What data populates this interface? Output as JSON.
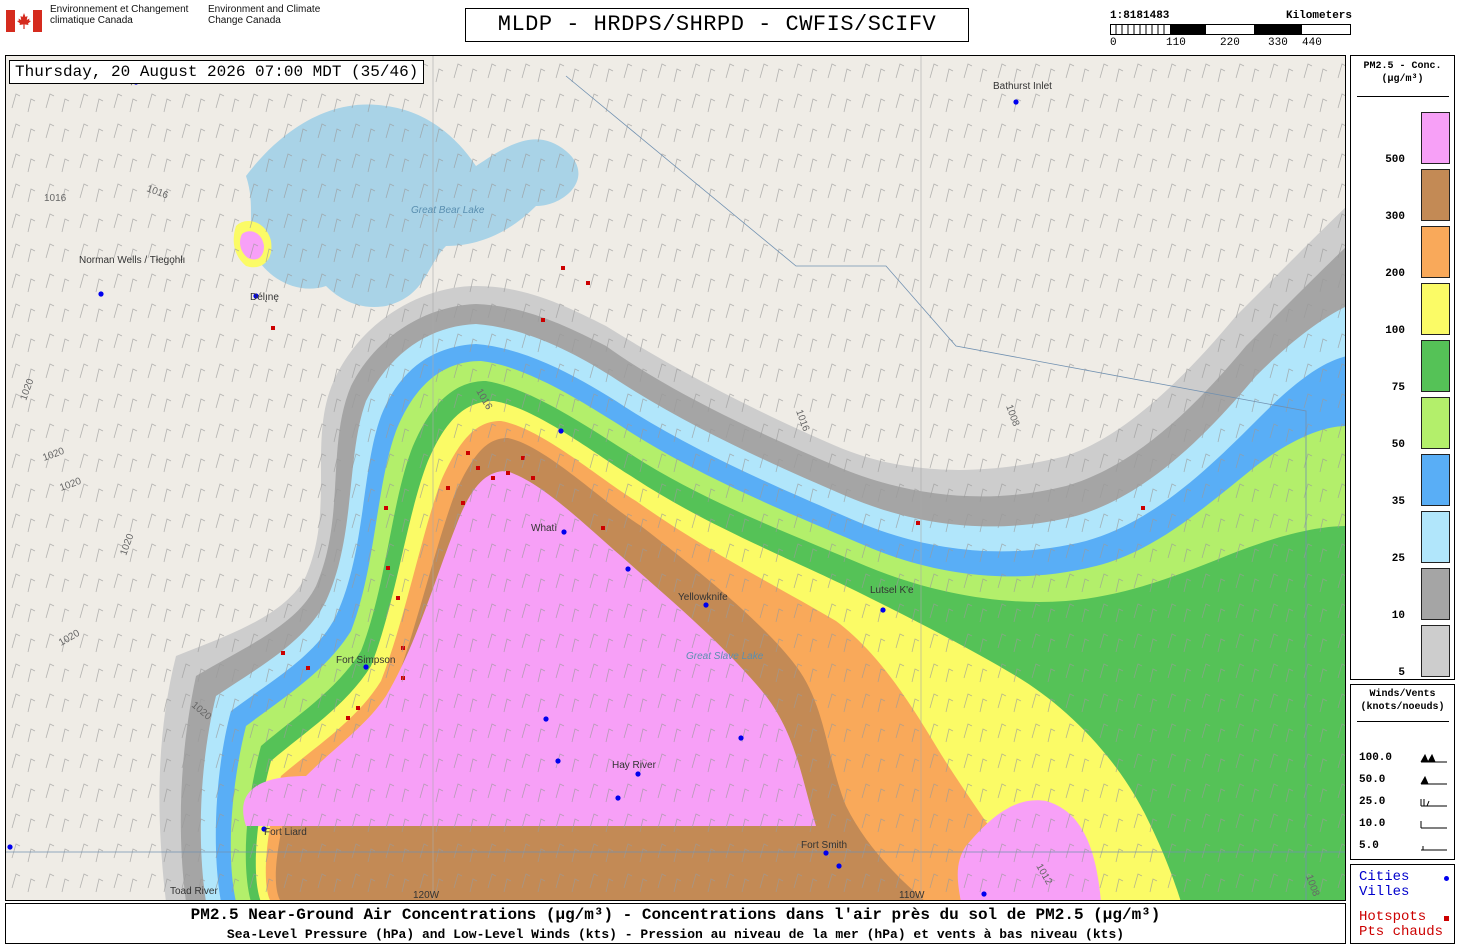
{
  "header": {
    "agency_fr": "Environnement et Changement climatique Canada",
    "agency_en": "Environment and Climate Change Canada",
    "product_title": "MLDP - HRDPS/SHRPD - CWFIS/SCIFV",
    "scale_ratio": "1:8181483",
    "scale_units": "Kilometers",
    "scale_ticks": [
      "0",
      "110",
      "220",
      "330",
      "440"
    ]
  },
  "map": {
    "timestamp": "Thursday, 20 August 2026 07:00 MDT (35/46)",
    "places": [
      {
        "name": "Norman Wells / Tłegǫhłı",
        "type": "city"
      },
      {
        "name": "Délı̨nę",
        "type": "city"
      },
      {
        "name": "Bathurst Inlet",
        "type": "city"
      },
      {
        "name": "Whatì",
        "type": "city"
      },
      {
        "name": "Yellowknife",
        "type": "city"
      },
      {
        "name": "Fort Simpson",
        "type": "city"
      },
      {
        "name": "Hay River",
        "type": "city"
      },
      {
        "name": "Fort Liard",
        "type": "city"
      },
      {
        "name": "Fort Smith",
        "type": "city"
      },
      {
        "name": "Lutsel K'e",
        "type": "city"
      },
      {
        "name": "Toad River",
        "type": "city"
      }
    ],
    "lakes": [
      "Great Bear Lake",
      "Great Slave Lake"
    ],
    "isobars": [
      "1016",
      "1016",
      "1016",
      "1020",
      "1020",
      "1020",
      "1020",
      "1020",
      "1020",
      "1016",
      "1016",
      "1008",
      "1008",
      "1012"
    ],
    "meridians": [
      "120W",
      "110W"
    ]
  },
  "legend_concentration": {
    "title": "PM2.5 - Conc. (µg/m³)",
    "levels": [
      {
        "label": "500",
        "color": "#f7a0f7"
      },
      {
        "label": "300",
        "color": "#c38a55"
      },
      {
        "label": "200",
        "color": "#f9a95a"
      },
      {
        "label": "100",
        "color": "#fbfb66"
      },
      {
        "label": "75",
        "color": "#55c257"
      },
      {
        "label": "50",
        "color": "#b3ef6b"
      },
      {
        "label": "35",
        "color": "#59aef6"
      },
      {
        "label": "25",
        "color": "#b1e6fb"
      },
      {
        "label": "10",
        "color": "#a5a5a5"
      },
      {
        "label": "5",
        "color": "#cdcdcd"
      }
    ]
  },
  "legend_winds": {
    "title": "Winds/Vents (knots/noeuds)",
    "rows": [
      {
        "label": "100.0"
      },
      {
        "label": "50.0"
      },
      {
        "label": "25.0"
      },
      {
        "label": "10.0"
      },
      {
        "label": "5.0"
      }
    ]
  },
  "legend_points": {
    "cities_en": "Cities",
    "cities_fr": "Villes",
    "hotspots_en": "Hotspots",
    "hotspots_fr": "Pts chauds",
    "city_color": "#0000ee",
    "hotspot_color": "#cc0000"
  },
  "footer": {
    "line1": "PM2.5 Near-Ground Air Concentrations (µg/m³) - Concentrations dans l'air près du sol de PM2.5 (µg/m³)",
    "line2": "Sea-Level Pressure (hPa) and Low-Level Winds (kts) - Pression au niveau de la mer (hPa) et vents à bas niveau (kts)"
  }
}
